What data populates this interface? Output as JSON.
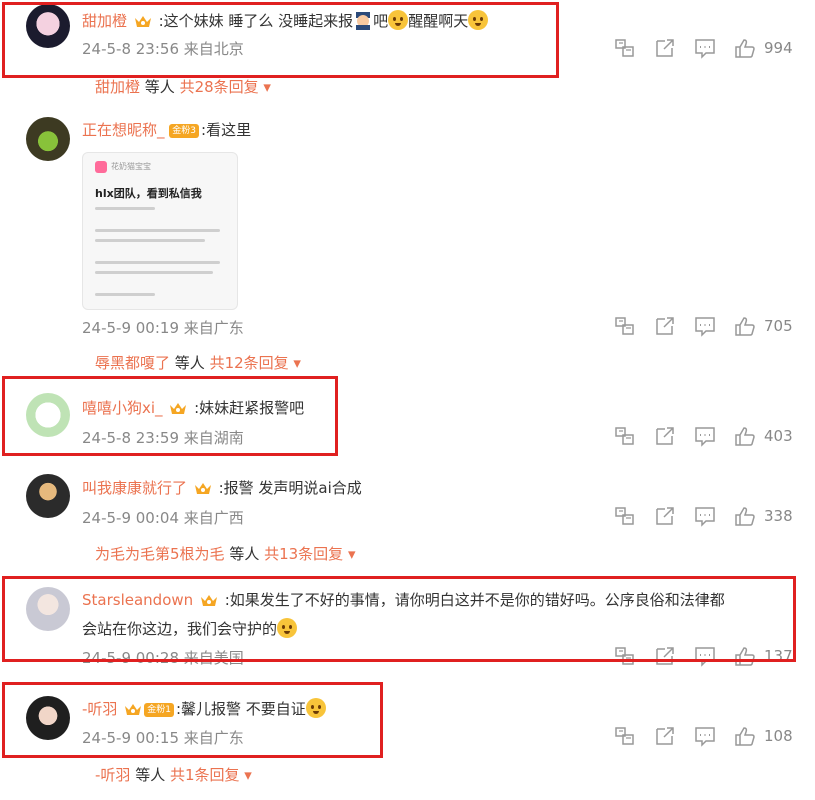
{
  "comments": [
    {
      "user": "甜加橙",
      "text": ":这个妹妹 睡了么 没睡起来报",
      "text2": "吧",
      "text3": "醒醒啊天",
      "time": "24-5-8 23:56 来自北京",
      "likes": "994",
      "replies": {
        "name": "甜加橙",
        "mid": " 等人 ",
        "count": "共28条回复 ▾"
      }
    },
    {
      "user": "正在想昵称_",
      "badge": "金粉3",
      "text": ":看这里",
      "time": "24-5-9 00:19 来自广东",
      "likes": "705",
      "replies": {
        "name": "辱黑都嗄了",
        "mid": " 等人 ",
        "count": "共12条回复 ▾"
      },
      "image": {
        "header": "花奶猫宝宝",
        "title": "hlx团队，看到私信我"
      }
    },
    {
      "user": "嘻嘻小狗xi_",
      "text": ":妹妹赶紧报警吧",
      "time": "24-5-8 23:59 来自湖南",
      "likes": "403"
    },
    {
      "user": "叫我康康就行了",
      "text": ":报警 发声明说ai合成",
      "time": "24-5-9 00:04 来自广西",
      "likes": "338",
      "replies": {
        "name": "为毛为毛第5根为毛",
        "mid": " 等人 ",
        "count": "共13条回复 ▾"
      }
    },
    {
      "user": "Starsleandown",
      "text": ":如果发生了不好的事情，请你明白这并不是你的错好吗。公序良俗和法律都",
      "text2": "会站在你这边，我们会守护的",
      "time": "24-5-9 00:28 来自美国",
      "likes": "137"
    },
    {
      "user": "-听羽",
      "badge": "金粉1",
      "text": ":馨儿报警 不要自证",
      "time": "24-5-9 00:15 来自广东",
      "likes": "108",
      "replies": {
        "name": "-听羽",
        "mid": " 等人 ",
        "count": "共1条回复 ▾"
      }
    }
  ],
  "colors": {
    "username": "#eb7350",
    "highlight": "#e02020",
    "meta": "#888888"
  },
  "icons": [
    "forward-icon",
    "share-icon",
    "comment-icon",
    "like-icon",
    "crown-icon",
    "emoji-icon"
  ]
}
